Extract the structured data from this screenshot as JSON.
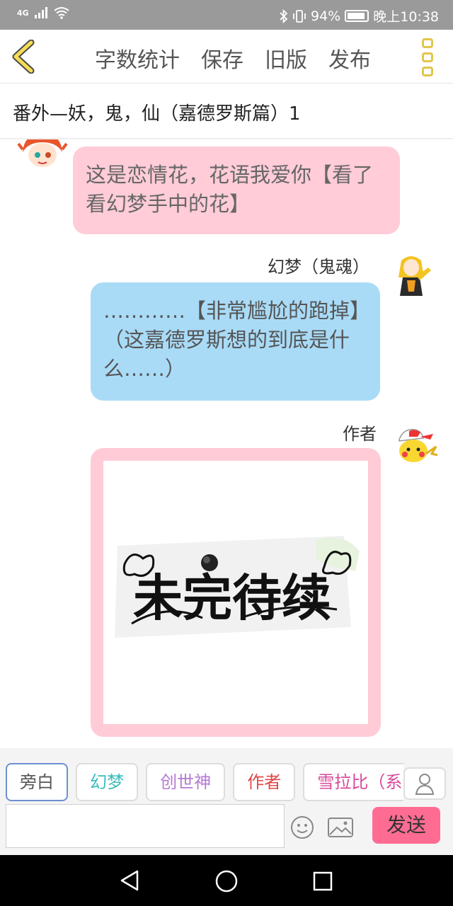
{
  "status_bar": {
    "network": "4G",
    "battery": "94%",
    "time": "晚上10:38"
  },
  "header": {
    "actions": [
      "字数统计",
      "保存",
      "旧版",
      "发布"
    ]
  },
  "chapter_title": "番外—妖，鬼，仙（嘉德罗斯篇）1",
  "messages": [
    {
      "text": "这是恋情花，花语我爱你【看了看幻梦手中的花】"
    },
    {
      "speaker": "幻梦（鬼魂）",
      "text": "…………【非常尴尬的跑掉】（这嘉德罗斯想的到底是什么……）"
    },
    {
      "speaker": "作者",
      "image_text": "未完待续"
    }
  ],
  "roles": [
    "旁白",
    "幻梦",
    "创世神",
    "作者",
    "雪拉比（系"
  ],
  "colors": {
    "pink_bubble": "#ffccd8",
    "blue_bubble": "#a9dbf7",
    "send": "#ff6c93",
    "role_colors": [
      "#555555",
      "#3bbcbc",
      "#b57ad3",
      "#e04848",
      "#d84a9a"
    ]
  },
  "input": {
    "placeholder": "",
    "send_label": "发送"
  }
}
